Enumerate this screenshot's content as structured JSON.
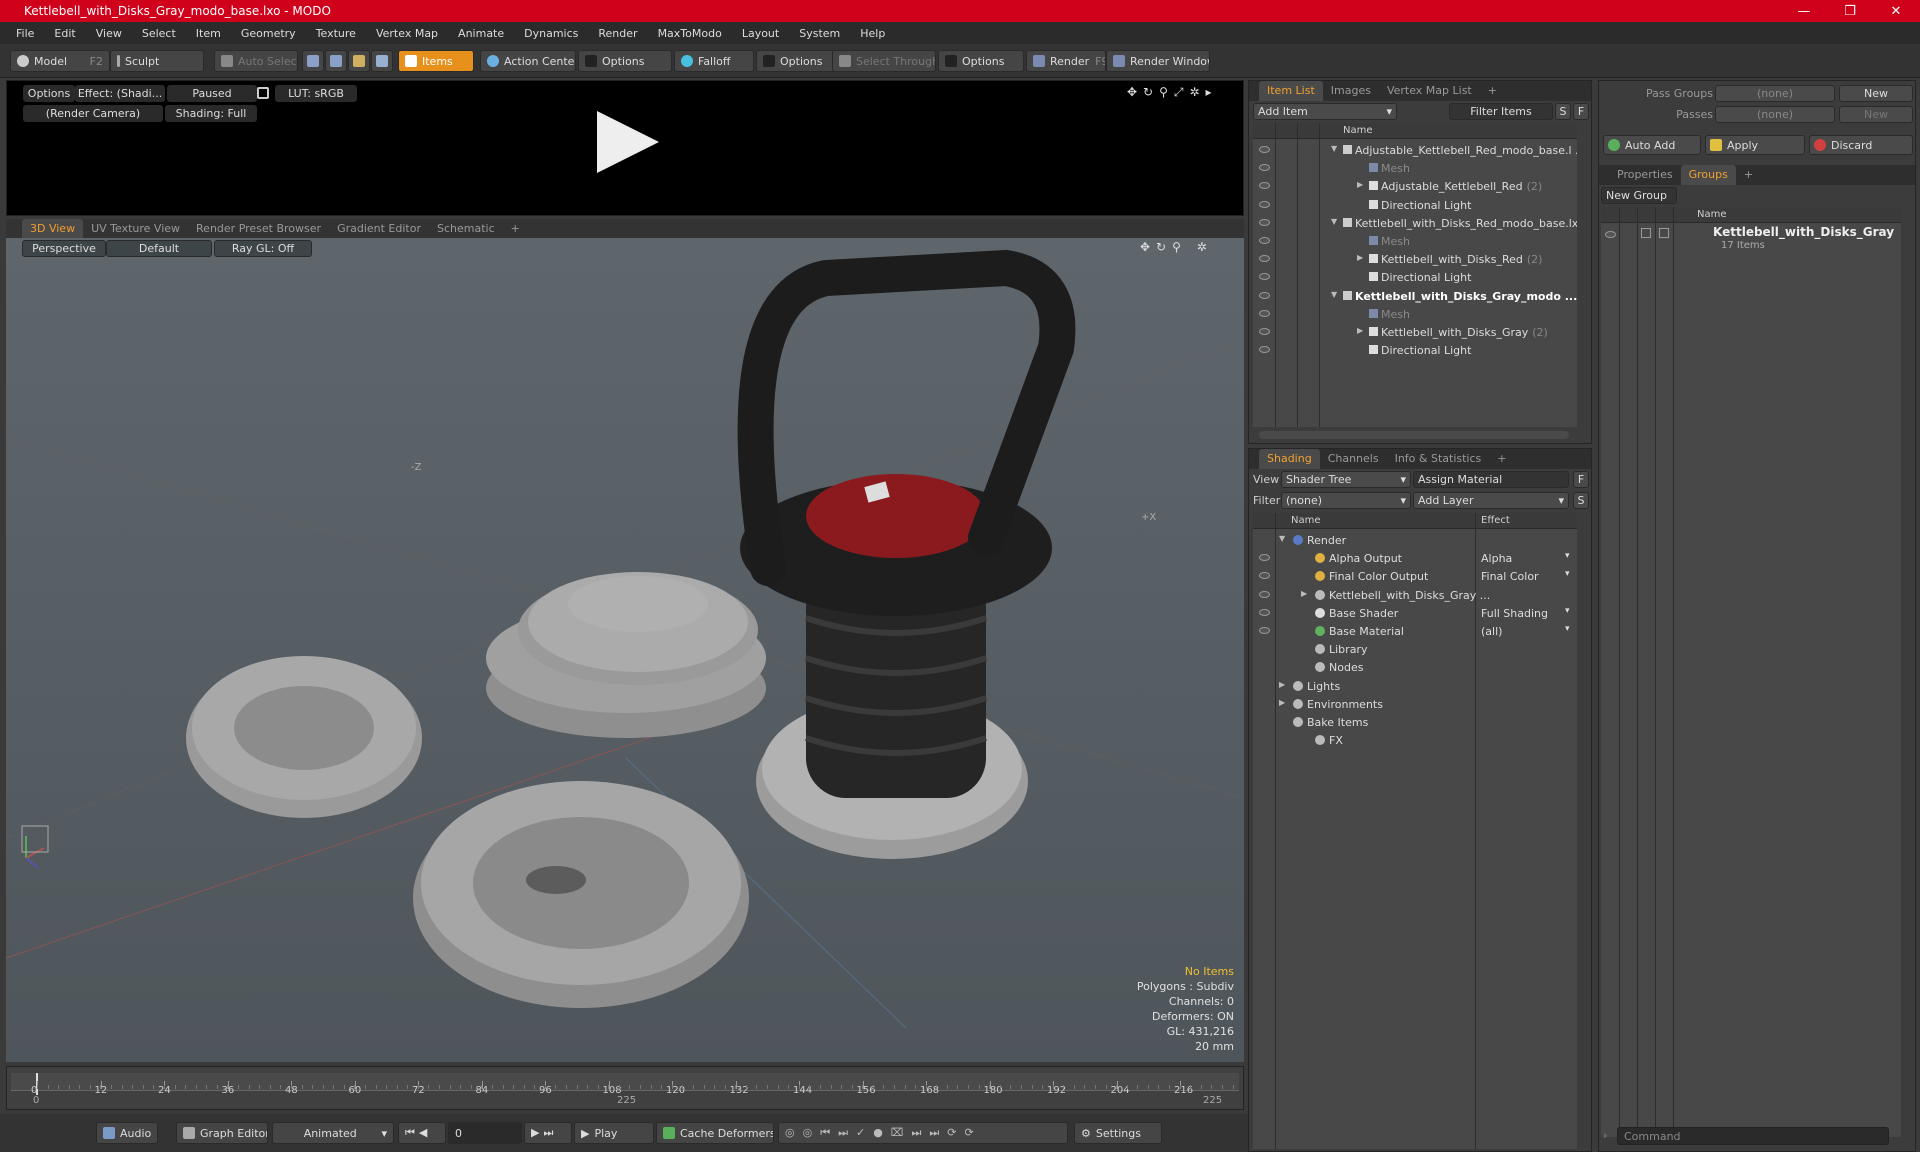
{
  "window": {
    "title": "Kettlebell_with_Disks_Gray_modo_base.lxo - MODO",
    "min": "—",
    "max": "❐",
    "close": "✕"
  },
  "menu": [
    "File",
    "Edit",
    "View",
    "Select",
    "Item",
    "Geometry",
    "Texture",
    "Vertex Map",
    "Animate",
    "Dynamics",
    "Render",
    "MaxToModo",
    "Layout",
    "System",
    "Help"
  ],
  "toolbar": {
    "model": "Model",
    "model_key": "F2",
    "sculpt": "Sculpt",
    "auto_select": "Auto Select",
    "items": "Items",
    "action_center": "Action Center",
    "options1": "Options",
    "falloff": "Falloff",
    "options2": "Options",
    "select_through": "Select Through",
    "options3": "Options",
    "render": "Render",
    "render_key": "F9",
    "render_window": "Render Window"
  },
  "preview": {
    "options": "Options",
    "effect": "Effect: (Shadi...",
    "paused": "Paused",
    "lut": "LUT: sRGB",
    "camera": "(Render Camera)",
    "shading": "Shading: Full"
  },
  "viewport_tabs": [
    "3D View",
    "UV Texture View",
    "Render Preset Browser",
    "Gradient Editor",
    "Schematic"
  ],
  "viewport_bar": {
    "perspective": "Perspective",
    "default": "Default",
    "raygl": "Ray GL: Off"
  },
  "viewport_info": {
    "no_items": "No Items",
    "polygons": "Polygons : Subdiv",
    "channels": "Channels: 0",
    "deformers": "Deformers: ON",
    "gl": "GL: 431,216",
    "scale": "20 mm"
  },
  "axis_labels": {
    "z": "-Z",
    "x": "+X"
  },
  "timeline": {
    "ticks": [
      "0",
      "12",
      "24",
      "36",
      "48",
      "60",
      "72",
      "84",
      "96",
      "108",
      "120",
      "132",
      "144",
      "156",
      "168",
      "180",
      "192",
      "204",
      "216"
    ],
    "start": "0",
    "mid": "225",
    "end": "225"
  },
  "bottom": {
    "audio": "Audio",
    "graph_editor": "Graph Editor",
    "animated": "Animated",
    "frame": "0",
    "play": "Play",
    "cache": "Cache Deformers",
    "settings": "Settings"
  },
  "item_list": {
    "tabs": [
      "Item List",
      "Images",
      "Vertex Map List"
    ],
    "add_item": "Add Item",
    "filter_items": "Filter Items",
    "s": "S",
    "f": "F",
    "col_name": "Name",
    "rows": [
      {
        "label": "Adjustable_Kettlebell_Red_modo_base.l ...",
        "indent": 0,
        "arrow": "▼",
        "bold": false,
        "dim": false
      },
      {
        "label": "Mesh",
        "indent": 1,
        "arrow": "",
        "bold": false,
        "dim": true
      },
      {
        "label": "Adjustable_Kettlebell_Red",
        "count": "(2)",
        "indent": 1,
        "arrow": "▶",
        "bold": false,
        "dim": false
      },
      {
        "label": "Directional Light",
        "indent": 1,
        "arrow": "",
        "bold": false,
        "dim": false
      },
      {
        "label": "Kettlebell_with_Disks_Red_modo_base.lxo",
        "indent": 0,
        "arrow": "▼",
        "bold": false,
        "dim": false
      },
      {
        "label": "Mesh",
        "indent": 1,
        "arrow": "",
        "bold": false,
        "dim": true
      },
      {
        "label": "Kettlebell_with_Disks_Red",
        "count": "(2)",
        "indent": 1,
        "arrow": "▶",
        "bold": false,
        "dim": false
      },
      {
        "label": "Directional Light",
        "indent": 1,
        "arrow": "",
        "bold": false,
        "dim": false
      },
      {
        "label": "Kettlebell_with_Disks_Gray_modo ...",
        "indent": 0,
        "arrow": "▼",
        "bold": true,
        "dim": false
      },
      {
        "label": "Mesh",
        "indent": 1,
        "arrow": "",
        "bold": false,
        "dim": true
      },
      {
        "label": "Kettlebell_with_Disks_Gray",
        "count": "(2)",
        "indent": 1,
        "arrow": "▶",
        "bold": false,
        "dim": false
      },
      {
        "label": "Directional Light",
        "indent": 1,
        "arrow": "",
        "bold": false,
        "dim": false
      }
    ]
  },
  "shading": {
    "tabs": [
      "Shading",
      "Channels",
      "Info & Statistics"
    ],
    "view_label": "View",
    "view_value": "Shader Tree",
    "assign_material": "Assign Material",
    "filter_label": "Filter",
    "filter_value": "(none)",
    "add_layer": "Add Layer",
    "f": "F",
    "s": "S",
    "col_name": "Name",
    "col_effect": "Effect",
    "rows": [
      {
        "label": "Render",
        "effect": "",
        "indent": 0,
        "arrow": "▼",
        "eye": false
      },
      {
        "label": "Alpha Output",
        "effect": "Alpha",
        "indent": 1,
        "arrow": "",
        "eye": true
      },
      {
        "label": "Final Color Output",
        "effect": "Final Color",
        "indent": 1,
        "arrow": "",
        "eye": true
      },
      {
        "label": "Kettlebell_with_Disks_Gray ...",
        "effect": "",
        "indent": 1,
        "arrow": "▶",
        "eye": true
      },
      {
        "label": "Base Shader",
        "effect": "Full Shading",
        "indent": 1,
        "arrow": "",
        "eye": true
      },
      {
        "label": "Base Material",
        "effect": "(all)",
        "indent": 1,
        "arrow": "",
        "eye": true
      },
      {
        "label": "Library",
        "effect": "",
        "indent": 1,
        "arrow": "",
        "eye": false
      },
      {
        "label": "Nodes",
        "effect": "",
        "indent": 1,
        "arrow": "",
        "eye": false
      },
      {
        "label": "Lights",
        "effect": "",
        "indent": 0,
        "arrow": "▶",
        "eye": false
      },
      {
        "label": "Environments",
        "effect": "",
        "indent": 0,
        "arrow": "▶",
        "eye": false
      },
      {
        "label": "Bake Items",
        "effect": "",
        "indent": 0,
        "arrow": "",
        "eye": false
      },
      {
        "label": "FX",
        "effect": "",
        "indent": 1,
        "arrow": "",
        "eye": false
      }
    ]
  },
  "groups": {
    "pass_groups": "Pass Groups",
    "passes": "Passes",
    "none1": "(none)",
    "none2": "(none)",
    "new": "New",
    "new2": "New",
    "auto_add": "Auto Add",
    "apply": "Apply",
    "discard": "Discard",
    "tabs": [
      "Properties",
      "Groups"
    ],
    "new_group": "New Group",
    "col_name": "Name",
    "group_name": "Kettlebell_with_Disks_Gray",
    "group_count": "17 Items"
  },
  "command": {
    "placeholder": "Command"
  }
}
